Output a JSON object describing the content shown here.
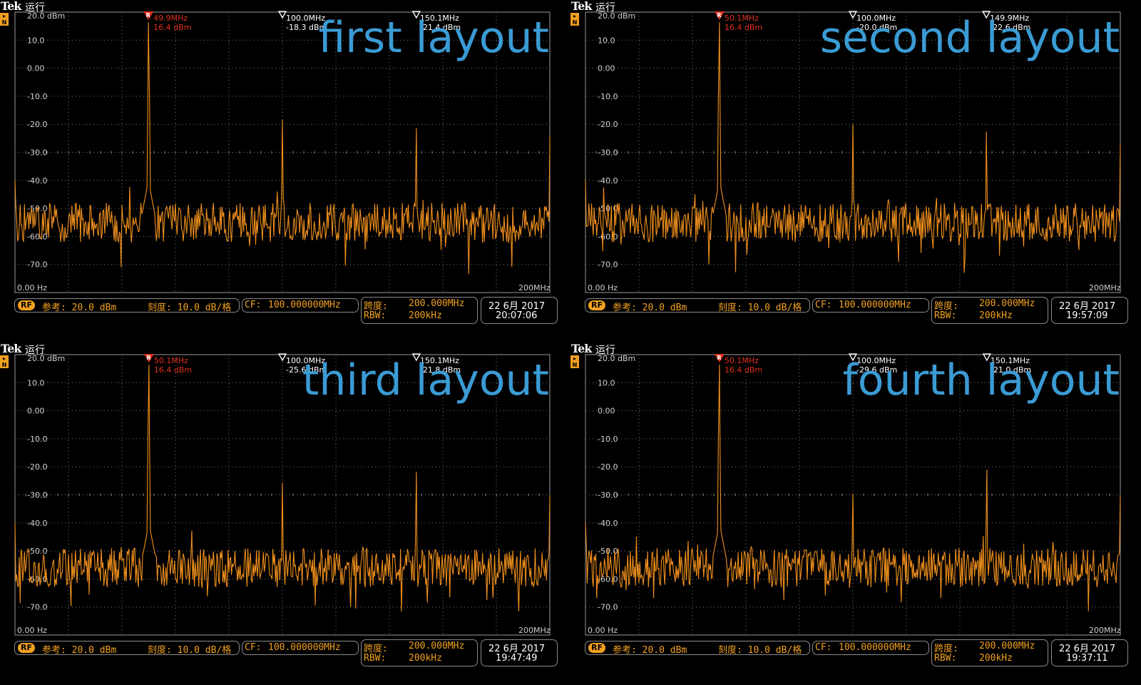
{
  "colors": {
    "trace": "#f0901c",
    "grid": "#7a7a7a",
    "marker_ref": "#e03020",
    "title": "#3b9bd4",
    "accent": "#f0a020"
  },
  "common": {
    "brand": "Tek",
    "status": "运行",
    "rf_badge": "RF",
    "ref_level": "参考: 20.0 dBm",
    "scale": "刻度: 10.0 dB/格",
    "cf_label": "CF:",
    "cf_value": "100.000000MHz",
    "span_label": "跨度:",
    "span_value": "200.000MHz",
    "rbw_label": "RBW:",
    "rbw_value": "200kHz",
    "x_start": "0.00 Hz",
    "x_end": "200MHz",
    "y_ticks": [
      "20.0 dBm",
      "10.0",
      "0.00",
      "-10.0",
      "-20.0",
      "-30.0",
      "-40.0",
      "-50.0",
      "-60.0",
      "-70.0"
    ]
  },
  "chart_data": [
    {
      "type": "line",
      "title": "first layout",
      "xlabel": "",
      "ylabel": "",
      "xlim": [
        0,
        200
      ],
      "ylim": [
        -80,
        20
      ],
      "x_unit": "MHz",
      "y_unit": "dBm",
      "markers": [
        {
          "symbol": "R",
          "freq": "49.9MHz",
          "level": "16.4 dBm",
          "x": 49.9,
          "y": 16.4
        },
        {
          "symbol": "▽",
          "freq": "100.0MHz",
          "level": "-18.3 dBm",
          "x": 100.0,
          "y": -18.3
        },
        {
          "symbol": "▽",
          "freq": "150.1MHz",
          "level": "-21.4 dBm",
          "x": 150.1,
          "y": -21.4
        }
      ],
      "noise_floor": -55,
      "spur_at_200": -24,
      "date": "22 6月 2017",
      "time": "20:07:06"
    },
    {
      "type": "line",
      "title": "second layout",
      "xlabel": "",
      "ylabel": "",
      "xlim": [
        0,
        200
      ],
      "ylim": [
        -80,
        20
      ],
      "x_unit": "MHz",
      "y_unit": "dBm",
      "markers": [
        {
          "symbol": "R",
          "freq": "50.1MHz",
          "level": "16.4 dBm",
          "x": 50.1,
          "y": 16.4
        },
        {
          "symbol": "▽",
          "freq": "100.0MHz",
          "level": "-20.0 dBm",
          "x": 100.0,
          "y": -20.0
        },
        {
          "symbol": "▽",
          "freq": "149.9MHz",
          "level": "-22.6 dBm",
          "x": 149.9,
          "y": -22.6
        }
      ],
      "noise_floor": -55,
      "spur_at_200": -27,
      "date": "22 6月 2017",
      "time": "19:57:09"
    },
    {
      "type": "line",
      "title": "third layout",
      "xlabel": "",
      "ylabel": "",
      "xlim": [
        0,
        200
      ],
      "ylim": [
        -80,
        20
      ],
      "x_unit": "MHz",
      "y_unit": "dBm",
      "markers": [
        {
          "symbol": "R",
          "freq": "50.1MHz",
          "level": "16.4 dBm",
          "x": 50.1,
          "y": 16.4
        },
        {
          "symbol": "▽",
          "freq": "100.0MHz",
          "level": "-25.6 dBm",
          "x": 100.0,
          "y": -25.6
        },
        {
          "symbol": "▽",
          "freq": "150.1MHz",
          "level": "-21.8 dBm",
          "x": 150.1,
          "y": -21.8
        }
      ],
      "noise_floor": -56,
      "spur_at_200": -30,
      "date": "22 6月 2017",
      "time": "19:47:49"
    },
    {
      "type": "line",
      "title": "fourth layout",
      "xlabel": "",
      "ylabel": "",
      "xlim": [
        0,
        200
      ],
      "ylim": [
        -80,
        20
      ],
      "x_unit": "MHz",
      "y_unit": "dBm",
      "markers": [
        {
          "symbol": "R",
          "freq": "50.1MHz",
          "level": "16.4 dBm",
          "x": 50.1,
          "y": 16.4
        },
        {
          "symbol": "▽",
          "freq": "100.0MHz",
          "level": "-29.6 dBm",
          "x": 100.0,
          "y": -29.6
        },
        {
          "symbol": "▽",
          "freq": "150.1MHz",
          "level": "-21.0 dBm",
          "x": 150.1,
          "y": -21.0
        }
      ],
      "noise_floor": -56,
      "spur_at_200": -30,
      "date": "22 6月 2017",
      "time": "19:37:11"
    }
  ]
}
